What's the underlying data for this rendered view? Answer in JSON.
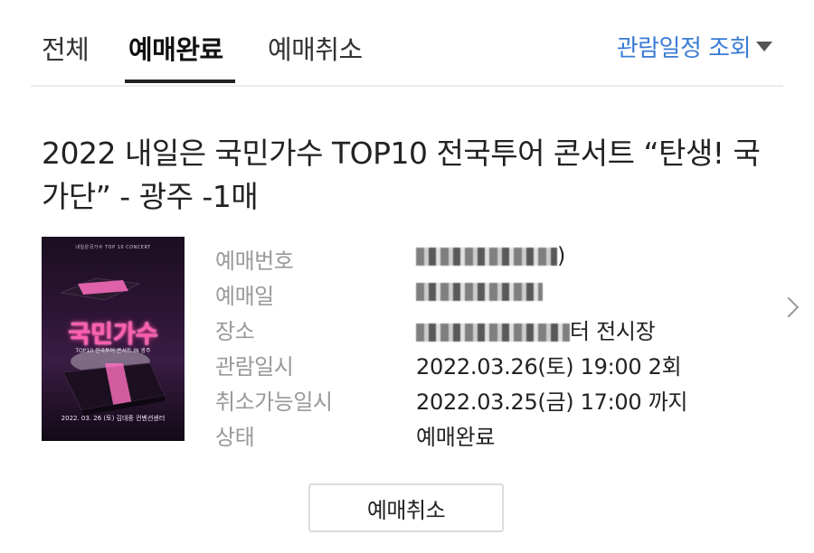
{
  "tabs": {
    "all": "전체",
    "completed": "예매완료",
    "cancelled": "예매취소",
    "active": "completed"
  },
  "schedule_link": {
    "label": "관람일정 조회"
  },
  "booking": {
    "title": "2022 내일은 국민가수 TOP10 전국투어 콘서트 “탄생! 국가단” - 광주 -1매",
    "poster": {
      "header": "내일은국가수 TOP 10 CONCERT",
      "title": "국민가수",
      "subtitle": "TOP10 전국투어 콘서트 IN 광주",
      "date": "2022. 03. 26 (토) 김대중 컨벤션센터"
    },
    "fields": {
      "booking_number": {
        "label": "예매번호",
        "value": ")"
      },
      "booking_date": {
        "label": "예매일",
        "value": ""
      },
      "venue": {
        "label": "장소",
        "value": "터 전시장"
      },
      "viewing_datetime": {
        "label": "관람일시",
        "value": "2022.03.26(토) 19:00 2회"
      },
      "cancel_deadline": {
        "label": "취소가능일시",
        "value": "2022.03.25(금) 17:00 까지"
      },
      "status": {
        "label": "상태",
        "value": "예매완료"
      }
    }
  },
  "actions": {
    "cancel_label": "예매취소"
  },
  "colors": {
    "link": "#3a7bd5",
    "text": "#222222",
    "label": "#999999",
    "border": "#dcdcdc"
  },
  "icons": {
    "dropdown": "caret-down-icon",
    "detail": "chevron-right-icon"
  }
}
